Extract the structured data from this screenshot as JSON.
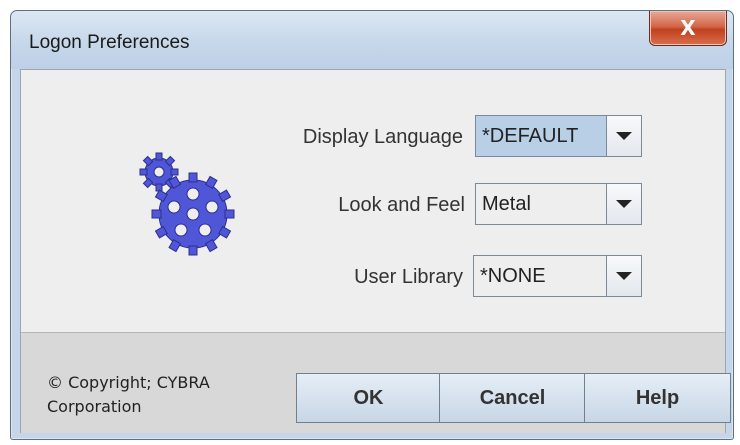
{
  "window": {
    "title": "Logon Preferences",
    "close_label": "X"
  },
  "form": {
    "display_language": {
      "label": "Display Language",
      "value": "*DEFAULT"
    },
    "look_and_feel": {
      "label": "Look and Feel",
      "value": "Metal"
    },
    "user_library": {
      "label": "User Library",
      "value": "*NONE"
    }
  },
  "footer": {
    "copyright": "© Copyright; CYBRA Corporation",
    "ok_label": "OK",
    "cancel_label": "Cancel",
    "help_label": "Help"
  },
  "icons": {
    "logo": "gears-icon",
    "dropdown": "chevron-down-icon"
  },
  "colors": {
    "gear_fill": "#4f57d8",
    "selected_field": "#b8cfe5",
    "close_button": "#c1401f"
  }
}
